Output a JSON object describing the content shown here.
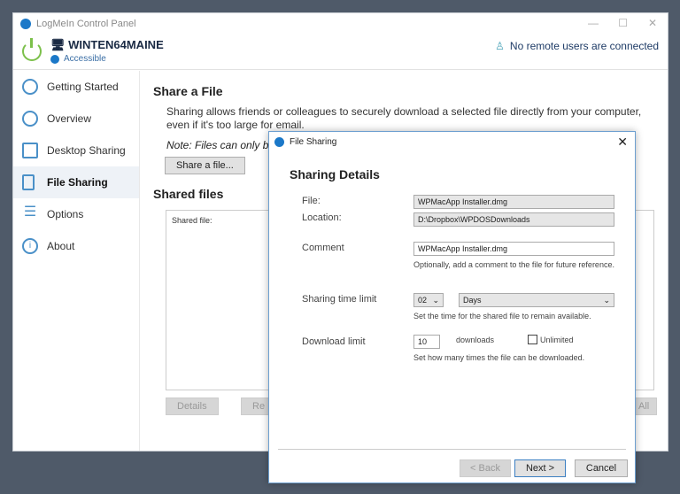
{
  "window": {
    "title": "LogMeIn Control Panel",
    "minimize": "—",
    "maximize": "☐",
    "close": "✕"
  },
  "header": {
    "machine": "WINTEN64MAINE",
    "status": "Accessible",
    "remote": "No remote users are connected"
  },
  "sidebar": {
    "items": [
      {
        "label": "Getting Started",
        "icon": "stopwatch-icon"
      },
      {
        "label": "Overview",
        "icon": "gauge-icon"
      },
      {
        "label": "Desktop Sharing",
        "icon": "monitor-icon"
      },
      {
        "label": "File Sharing",
        "icon": "file-icon",
        "active": true
      },
      {
        "label": "Options",
        "icon": "sliders-icon"
      },
      {
        "label": "About",
        "icon": "info-icon"
      }
    ]
  },
  "main": {
    "title": "Share a File",
    "description": "Sharing allows friends or colleagues to securely download a selected file directly from your computer, even if it's too large for email.",
    "note": "Note: Files can only be",
    "share_button": "Share a file...",
    "shared_title": "Shared files",
    "column": "Shared file:",
    "details_button": "Details",
    "remove_button": "Re",
    "remove_all_button": "All"
  },
  "dialog": {
    "title": "File Sharing",
    "heading": "Sharing Details",
    "file_label": "File:",
    "file_value": "WPMacApp Installer.dmg",
    "location_label": "Location:",
    "location_value": "D:\\Dropbox\\WPDOSDownloads",
    "comment_label": "Comment",
    "comment_value": "WPMacApp Installer.dmg",
    "comment_hint": "Optionally, add a comment to the file for future reference.",
    "time_label": "Sharing time limit",
    "time_value": "02",
    "time_unit": "Days",
    "time_hint": "Set the time for the shared file to remain available.",
    "download_label": "Download limit",
    "download_value": "10",
    "downloads_text": "downloads",
    "unlimited_label": "Unlimited",
    "unlimited_checked": false,
    "download_hint": "Set how many times the file can be downloaded.",
    "back": "< Back",
    "next": "Next >",
    "cancel": "Cancel",
    "close": "✕"
  }
}
